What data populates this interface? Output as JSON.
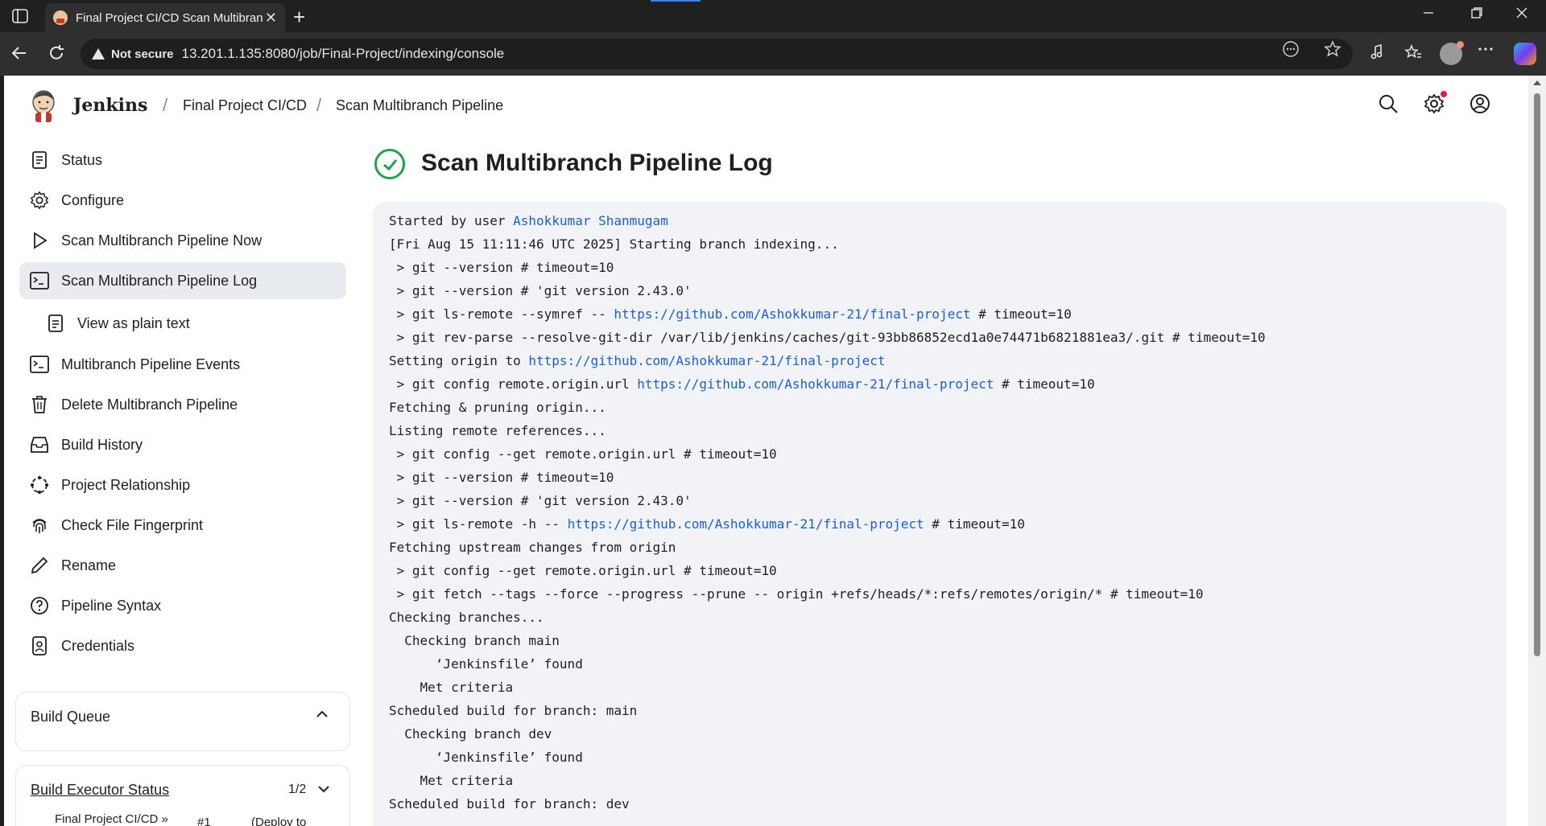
{
  "browser": {
    "tab_title": "Final Project CI/CD Scan Multibranch",
    "tab_close": "✕",
    "new_tab": "+",
    "security_label": "Not secure",
    "url": "13.201.1.135:8080/job/Final-Project/indexing/console"
  },
  "header": {
    "brand": "Jenkins",
    "breadcrumbs": [
      "Final Project CI/CD",
      "Scan Multibranch Pipeline"
    ]
  },
  "sidebar": {
    "items": [
      {
        "label": "Status",
        "icon": "document-icon"
      },
      {
        "label": "Configure",
        "icon": "gear-icon"
      },
      {
        "label": "Scan Multibranch Pipeline Now",
        "icon": "play-icon"
      },
      {
        "label": "Scan Multibranch Pipeline Log",
        "icon": "terminal-icon"
      },
      {
        "label": "View as plain text",
        "icon": "document-icon"
      },
      {
        "label": "Multibranch Pipeline Events",
        "icon": "terminal-icon"
      },
      {
        "label": "Delete Multibranch Pipeline",
        "icon": "trash-icon"
      },
      {
        "label": "Build History",
        "icon": "inbox-icon"
      },
      {
        "label": "Project Relationship",
        "icon": "relationship-icon"
      },
      {
        "label": "Check File Fingerprint",
        "icon": "fingerprint-icon"
      },
      {
        "label": "Rename",
        "icon": "pencil-icon"
      },
      {
        "label": "Pipeline Syntax",
        "icon": "help-icon"
      },
      {
        "label": "Credentials",
        "icon": "credentials-icon"
      }
    ],
    "build_queue": {
      "title": "Build Queue"
    },
    "executor": {
      "title": "Build Executor Status",
      "count": "1/2",
      "row_job": "Final Project CI/CD »",
      "row_num": "#1",
      "row_stage": "(Deploy to"
    }
  },
  "main": {
    "title": "Scan Multibranch Pipeline Log",
    "status_color": "#1ea446",
    "log": [
      {
        "pre": "Started by user ",
        "link": "Ashokkumar Shanmugam",
        "post": ""
      },
      {
        "pre": "[Fri Aug 15 11:11:46 UTC 2025] Starting branch indexing...",
        "link": "",
        "post": ""
      },
      {
        "pre": " > git --version # timeout=10",
        "link": "",
        "post": ""
      },
      {
        "pre": " > git --version # 'git version 2.43.0'",
        "link": "",
        "post": ""
      },
      {
        "pre": " > git ls-remote --symref -- ",
        "link": "https://github.com/Ashokkumar-21/final-project",
        "post": " # timeout=10"
      },
      {
        "pre": " > git rev-parse --resolve-git-dir /var/lib/jenkins/caches/git-93bb86852ecd1a0e74471b6821881ea3/.git # timeout=10",
        "link": "",
        "post": ""
      },
      {
        "pre": "Setting origin to ",
        "link": "https://github.com/Ashokkumar-21/final-project",
        "post": ""
      },
      {
        "pre": " > git config remote.origin.url ",
        "link": "https://github.com/Ashokkumar-21/final-project",
        "post": " # timeout=10"
      },
      {
        "pre": "Fetching & pruning origin...",
        "link": "",
        "post": ""
      },
      {
        "pre": "Listing remote references...",
        "link": "",
        "post": ""
      },
      {
        "pre": " > git config --get remote.origin.url # timeout=10",
        "link": "",
        "post": ""
      },
      {
        "pre": " > git --version # timeout=10",
        "link": "",
        "post": ""
      },
      {
        "pre": " > git --version # 'git version 2.43.0'",
        "link": "",
        "post": ""
      },
      {
        "pre": " > git ls-remote -h -- ",
        "link": "https://github.com/Ashokkumar-21/final-project",
        "post": " # timeout=10"
      },
      {
        "pre": "Fetching upstream changes from origin",
        "link": "",
        "post": ""
      },
      {
        "pre": " > git config --get remote.origin.url # timeout=10",
        "link": "",
        "post": ""
      },
      {
        "pre": " > git fetch --tags --force --progress --prune -- origin +refs/heads/*:refs/remotes/origin/* # timeout=10",
        "link": "",
        "post": ""
      },
      {
        "pre": "Checking branches...",
        "link": "",
        "post": ""
      },
      {
        "pre": "  Checking branch main",
        "link": "",
        "post": ""
      },
      {
        "pre": "      ‘Jenkinsfile’ found",
        "link": "",
        "post": ""
      },
      {
        "pre": "    Met criteria",
        "link": "",
        "post": ""
      },
      {
        "pre": "Scheduled build for branch: main",
        "link": "",
        "post": ""
      },
      {
        "pre": "  Checking branch dev",
        "link": "",
        "post": ""
      },
      {
        "pre": "      ‘Jenkinsfile’ found",
        "link": "",
        "post": ""
      },
      {
        "pre": "    Met criteria",
        "link": "",
        "post": ""
      },
      {
        "pre": "Scheduled build for branch: dev",
        "link": "",
        "post": ""
      }
    ]
  }
}
